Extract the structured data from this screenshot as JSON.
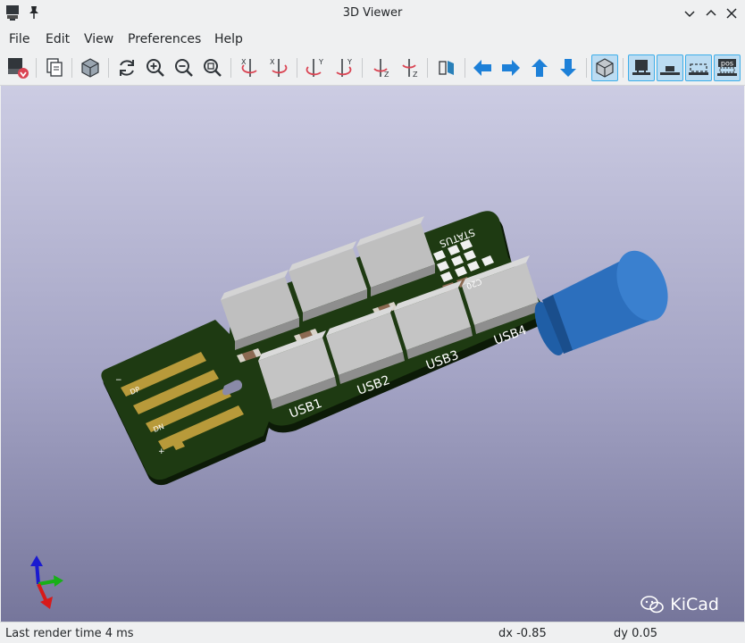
{
  "window": {
    "title": "3D Viewer",
    "app_icon": "kicad-3d-icon",
    "pin_icon": "pin-icon",
    "controls": [
      "minimize-icon",
      "maximize-icon",
      "close-icon"
    ]
  },
  "menu": {
    "items": [
      {
        "label": "File"
      },
      {
        "label": "Edit"
      },
      {
        "label": "View"
      },
      {
        "label": "Preferences"
      },
      {
        "label": "Help"
      }
    ]
  },
  "toolbar": {
    "buttons": [
      {
        "icon": "reload-board-icon"
      },
      {
        "icon": "copy-3d-image-icon"
      },
      {
        "icon": "raytracing-cube-icon"
      },
      {
        "icon": "refresh-icon"
      },
      {
        "icon": "zoom-in-icon"
      },
      {
        "icon": "zoom-out-icon"
      },
      {
        "icon": "zoom-fit-icon"
      },
      {
        "icon": "rotate-x-cw-icon"
      },
      {
        "icon": "rotate-x-ccw-icon"
      },
      {
        "icon": "rotate-y-cw-icon"
      },
      {
        "icon": "rotate-y-ccw-icon"
      },
      {
        "icon": "rotate-z-cw-icon"
      },
      {
        "icon": "rotate-z-ccw-icon"
      },
      {
        "icon": "flip-board-icon"
      },
      {
        "icon": "move-left-icon"
      },
      {
        "icon": "move-right-icon"
      },
      {
        "icon": "move-up-icon"
      },
      {
        "icon": "move-down-icon"
      },
      {
        "icon": "orthographic-toggle-icon",
        "active": true
      },
      {
        "icon": "show-tht-icon",
        "active": true
      },
      {
        "icon": "show-smd-icon",
        "active": true
      },
      {
        "icon": "show-virtual-icon",
        "active": true
      },
      {
        "icon": "show-not-in-posfile-icon",
        "active": true,
        "text": "pos"
      }
    ]
  },
  "board": {
    "silkscreen": {
      "usb_labels": [
        "USB1",
        "USB2",
        "USB3",
        "USB4"
      ],
      "status": "STATUS",
      "cap_ref": "C20",
      "dp": "DP",
      "dn": "DN",
      "minus": "−",
      "plus": "+"
    },
    "colors": {
      "pcb": "#1e3a12",
      "gold": "#b89a3a",
      "capacitor": "#2e74c4",
      "background_top": "#cccce3",
      "background_bottom": "#76769b"
    }
  },
  "watermark": {
    "text": "KiCad",
    "icon": "wechat-icon"
  },
  "status": {
    "render_time": "Last render time 4 ms",
    "dx": "dx -0.85",
    "dy": "dy 0.05"
  }
}
